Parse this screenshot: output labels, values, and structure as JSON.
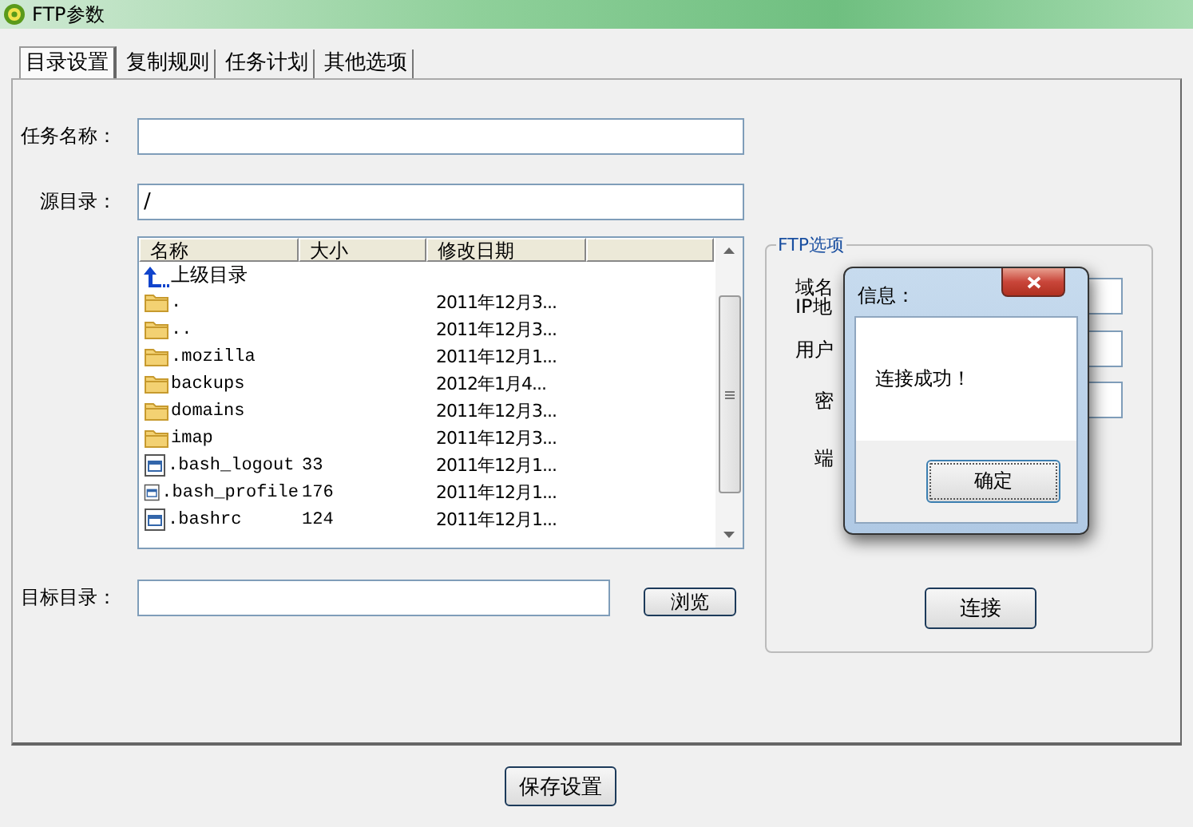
{
  "window": {
    "title": "FTP参数"
  },
  "tabs": [
    {
      "label": "目录设置",
      "selected": true
    },
    {
      "label": "复制规则",
      "selected": false
    },
    {
      "label": "任务计划",
      "selected": false
    },
    {
      "label": "其他选项",
      "selected": false
    }
  ],
  "task_name": {
    "label": "任务名称："
  },
  "source_dir": {
    "label": "源目录：",
    "value": "/"
  },
  "file_list": {
    "columns": [
      "名称",
      "大小",
      "修改日期"
    ],
    "rows": [
      {
        "kind": "up",
        "name": "上级目录"
      },
      {
        "kind": "folder",
        "name": ".",
        "modified": "2011年12月3..."
      },
      {
        "kind": "folder",
        "name": "..",
        "modified": "2011年12月3..."
      },
      {
        "kind": "folder",
        "name": ".mozilla",
        "modified": "2011年12月1..."
      },
      {
        "kind": "folder",
        "name": "backups",
        "modified": "2012年1月4..."
      },
      {
        "kind": "folder",
        "name": "domains",
        "modified": "2011年12月3..."
      },
      {
        "kind": "folder",
        "name": "imap",
        "modified": "2011年12月3..."
      },
      {
        "kind": "file",
        "name": ".bash_logout",
        "size": "33",
        "modified": "2011年12月1..."
      },
      {
        "kind": "file",
        "name": ".bash_profile",
        "size": "176",
        "modified": "2011年12月1..."
      },
      {
        "kind": "file",
        "name": ".bashrc",
        "size": "124",
        "modified": "2011年12月1..."
      }
    ]
  },
  "target_dir": {
    "label": "目标目录：",
    "browse_button": "浏览"
  },
  "ftp_options": {
    "title": "FTP选项",
    "host_label": [
      "域名",
      "IP地"
    ],
    "user_label": "用户",
    "password_label": "密",
    "port_label": "端",
    "connect_button": "连接"
  },
  "dialog": {
    "title": "信息：",
    "message": "连接成功！",
    "ok_button": "确定"
  },
  "save_button": "保存设置"
}
